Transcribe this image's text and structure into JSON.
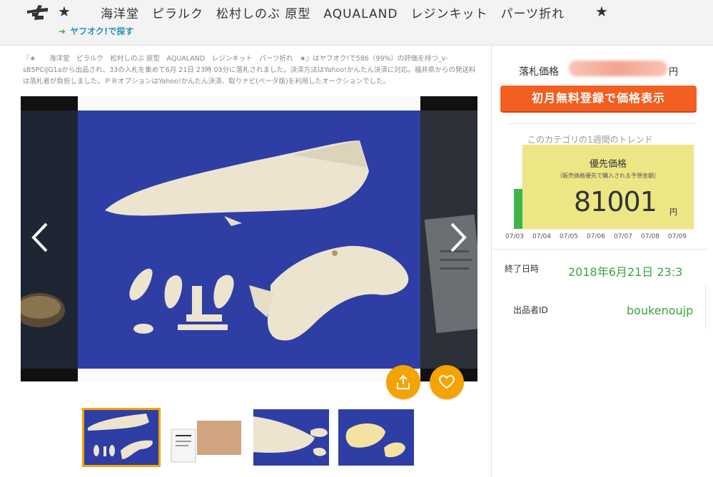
{
  "header": {
    "star": "★",
    "title": "海洋堂　ピラルク　松村しのぶ 原型　AQUALAND　レジンキット　パーツ折れ",
    "search_link": "ヤフオク!で探す",
    "arrow": "➜"
  },
  "description": "『★　　海洋堂　ピラルク　松村しのぶ 原型　AQUALAND　レジンキット　パーツ折れ　★』はヤフオク!で586（99%）の評価を持つ_v-sB5PCiJG1aから出品され、33の入札を集めて6月 21日 23時 03分に落札されました。決済方法はYahoo!かんたん決済に対応。福井県からの発送料は落札者が負担しました。ＰＲオプションはYahoo!かんたん決済、取りナビ(ベータ版)を利用したオークションでした。",
  "price": {
    "label": "落札価格",
    "unit": "円",
    "cta": "初月無料登録で価格表示"
  },
  "trend": {
    "title": "このカテゴリの1週間のトレンド",
    "tooltip_title": "優先価格",
    "tooltip_sub": "（販売価格優先で購入される予想金額）",
    "tooltip_value": "81001",
    "tooltip_unit": "円",
    "dates": [
      "07/03",
      "07/04",
      "07/05",
      "07/06",
      "07/07",
      "07/08",
      "07/09"
    ]
  },
  "info": {
    "end_label": "終了日時",
    "end_value": "2018年6月21日 23:3",
    "seller_label": "出品者ID",
    "seller_value": "boukenoujp"
  },
  "colors": {
    "accent_orange": "#f5a300",
    "cta_orange": "#f25f20",
    "link_blue": "#2d8fb8",
    "green": "#3aa53d",
    "tooltip_yellow": "#ede685",
    "photo_blue": "#2e3ea5"
  },
  "icons": {
    "prev": "chevron-left-icon",
    "next": "chevron-right-icon",
    "share": "share-icon",
    "like": "heart-icon"
  }
}
